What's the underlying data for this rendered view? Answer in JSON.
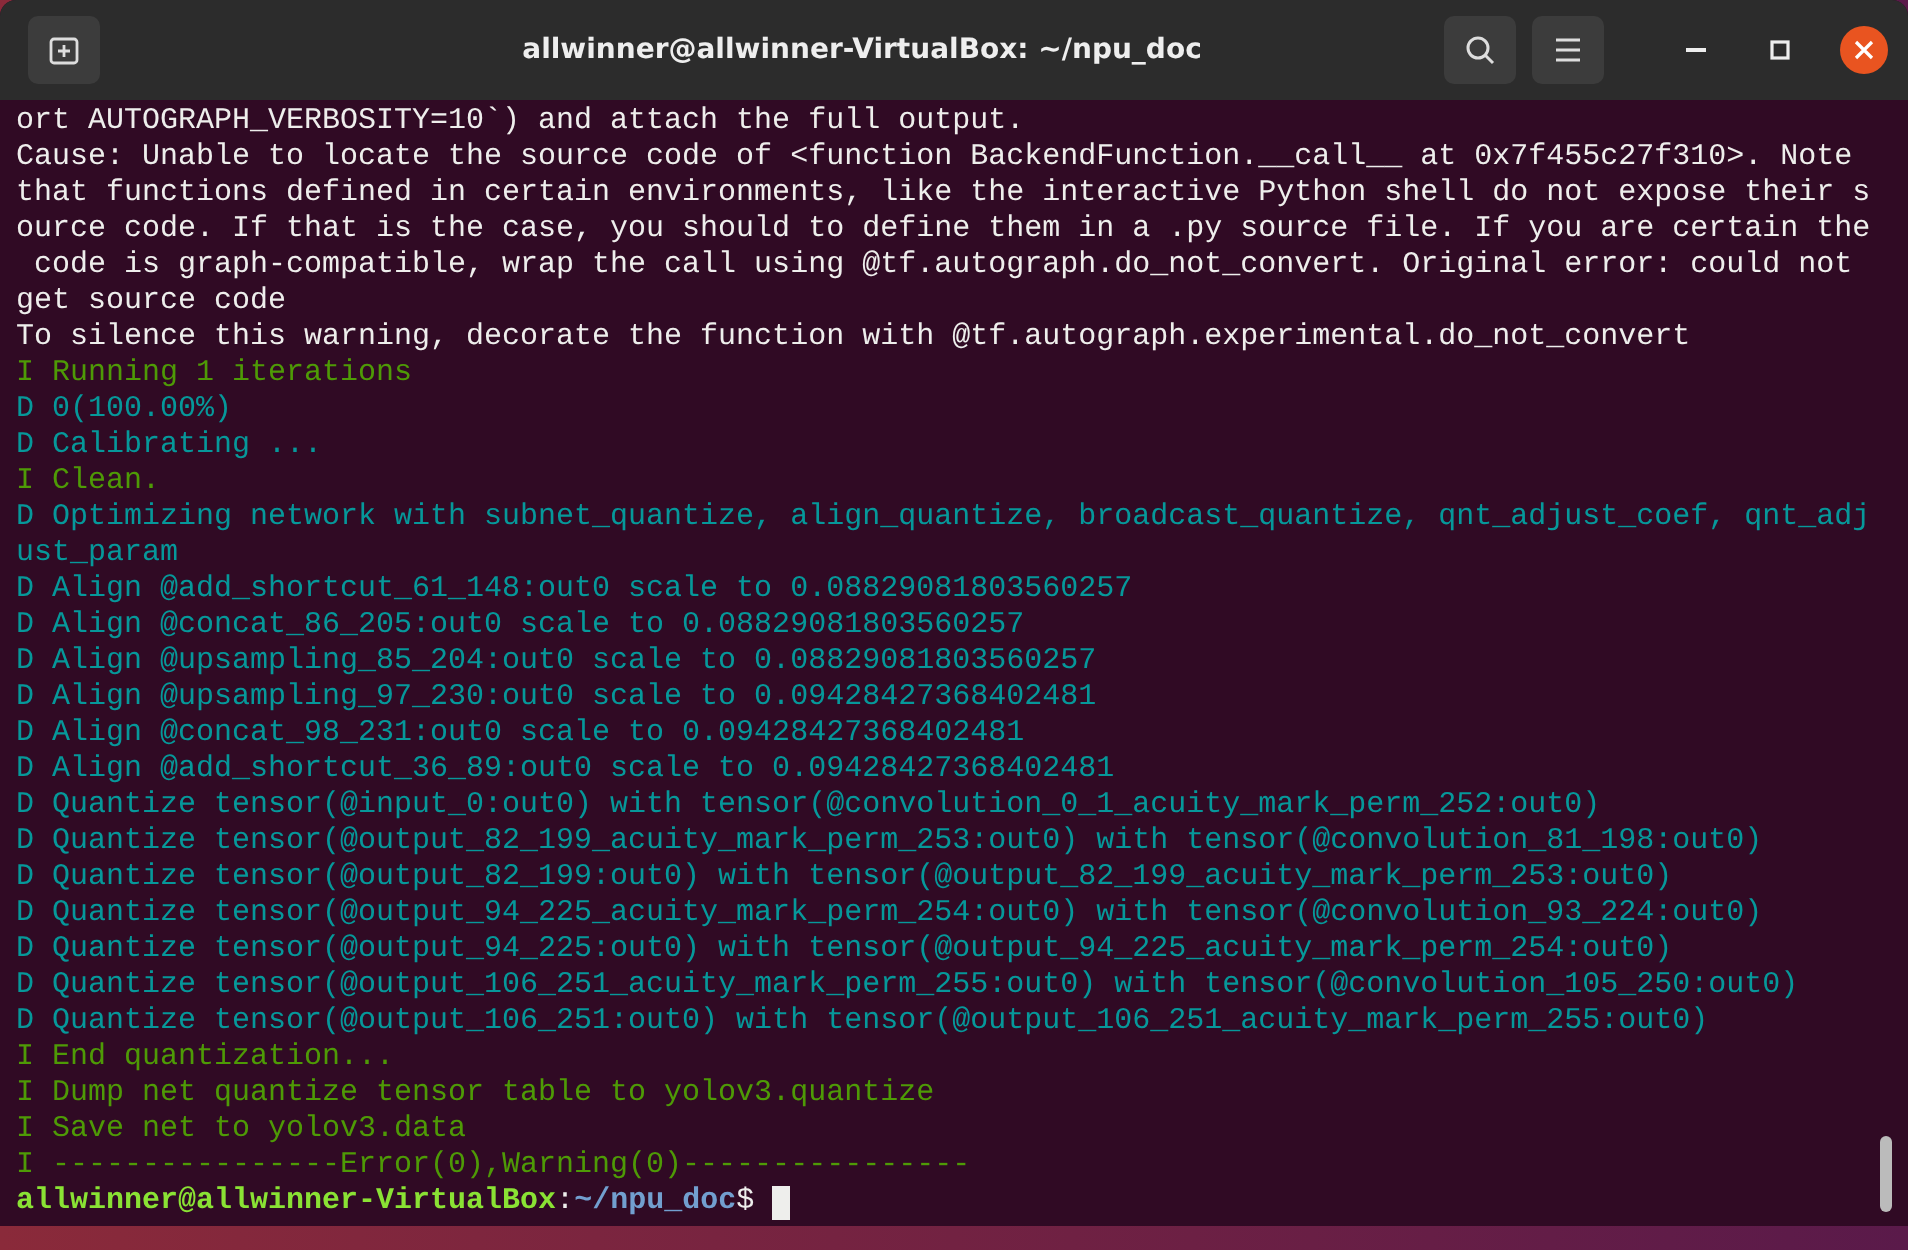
{
  "window": {
    "title": "allwinner@allwinner-VirtualBox: ~/npu_doc"
  },
  "terminal": {
    "lines": [
      {
        "kind": "plain",
        "text": "ort AUTOGRAPH_VERBOSITY=10`) and attach the full output."
      },
      {
        "kind": "plain",
        "text": "Cause: Unable to locate the source code of <function BackendFunction.__call__ at 0x7f455c27f310>. Note"
      },
      {
        "kind": "plain",
        "text": "that functions defined in certain environments, like the interactive Python shell do not expose their s"
      },
      {
        "kind": "plain",
        "text": "ource code. If that is the case, you should to define them in a .py source file. If you are certain the"
      },
      {
        "kind": "plain",
        "text": " code is graph-compatible, wrap the call using @tf.autograph.do_not_convert. Original error: could not"
      },
      {
        "kind": "plain",
        "text": "get source code"
      },
      {
        "kind": "plain",
        "text": "To silence this warning, decorate the function with @tf.autograph.experimental.do_not_convert"
      },
      {
        "kind": "info",
        "text": "I Running 1 iterations"
      },
      {
        "kind": "debug",
        "text": "D 0(100.00%)"
      },
      {
        "kind": "debug",
        "text": "D Calibrating ..."
      },
      {
        "kind": "info",
        "text": "I Clean."
      },
      {
        "kind": "debug",
        "text": "D Optimizing network with subnet_quantize, align_quantize, broadcast_quantize, qnt_adjust_coef, qnt_adj"
      },
      {
        "kind": "debug",
        "text": "ust_param"
      },
      {
        "kind": "debug",
        "text": "D Align @add_shortcut_61_148:out0 scale to 0.08829081803560257"
      },
      {
        "kind": "debug",
        "text": "D Align @concat_86_205:out0 scale to 0.08829081803560257"
      },
      {
        "kind": "debug",
        "text": "D Align @upsampling_85_204:out0 scale to 0.08829081803560257"
      },
      {
        "kind": "debug",
        "text": "D Align @upsampling_97_230:out0 scale to 0.09428427368402481"
      },
      {
        "kind": "debug",
        "text": "D Align @concat_98_231:out0 scale to 0.09428427368402481"
      },
      {
        "kind": "debug",
        "text": "D Align @add_shortcut_36_89:out0 scale to 0.09428427368402481"
      },
      {
        "kind": "debug",
        "text": "D Quantize tensor(@input_0:out0) with tensor(@convolution_0_1_acuity_mark_perm_252:out0)"
      },
      {
        "kind": "debug",
        "text": "D Quantize tensor(@output_82_199_acuity_mark_perm_253:out0) with tensor(@convolution_81_198:out0)"
      },
      {
        "kind": "debug",
        "text": "D Quantize tensor(@output_82_199:out0) with tensor(@output_82_199_acuity_mark_perm_253:out0)"
      },
      {
        "kind": "debug",
        "text": "D Quantize tensor(@output_94_225_acuity_mark_perm_254:out0) with tensor(@convolution_93_224:out0)"
      },
      {
        "kind": "debug",
        "text": "D Quantize tensor(@output_94_225:out0) with tensor(@output_94_225_acuity_mark_perm_254:out0)"
      },
      {
        "kind": "debug",
        "text": "D Quantize tensor(@output_106_251_acuity_mark_perm_255:out0) with tensor(@convolution_105_250:out0)"
      },
      {
        "kind": "debug",
        "text": "D Quantize tensor(@output_106_251:out0) with tensor(@output_106_251_acuity_mark_perm_255:out0)"
      },
      {
        "kind": "info",
        "text": "I End quantization..."
      },
      {
        "kind": "info",
        "text": "I Dump net quantize tensor table to yolov3.quantize"
      },
      {
        "kind": "info",
        "text": "I Save net to yolov3.data"
      },
      {
        "kind": "info",
        "text": "I ----------------Error(0),Warning(0)----------------"
      }
    ],
    "prompt": {
      "user_host": "allwinner@allwinner-VirtualBox",
      "separator": ":",
      "path": "~/npu_doc",
      "symbol": "$"
    }
  }
}
